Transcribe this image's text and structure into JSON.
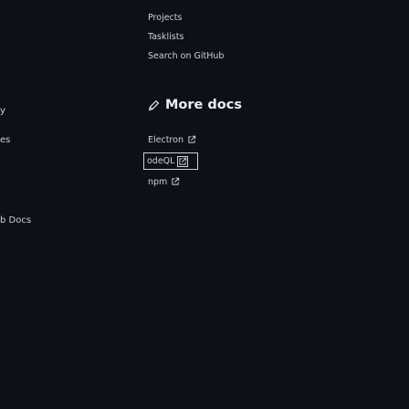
{
  "left_column": {
    "fragment_1": "y",
    "fragment_2": "es",
    "fragment_3": "b Docs"
  },
  "top_links": {
    "projects": "Projects",
    "tasklists": "Tasklists",
    "search_github": "Search on GitHub"
  },
  "more_docs": {
    "title": "More docs",
    "icon": "pencil-icon",
    "links": [
      {
        "label": "Electron",
        "icon": "external-link-icon"
      },
      {
        "label": "odeQL",
        "icon": "external-link-icon"
      },
      {
        "label": "npm",
        "icon": "external-link-icon"
      }
    ]
  },
  "colors": {
    "background": "#0d1117",
    "text": "#c9d1d9",
    "title": "#e6edf3"
  }
}
